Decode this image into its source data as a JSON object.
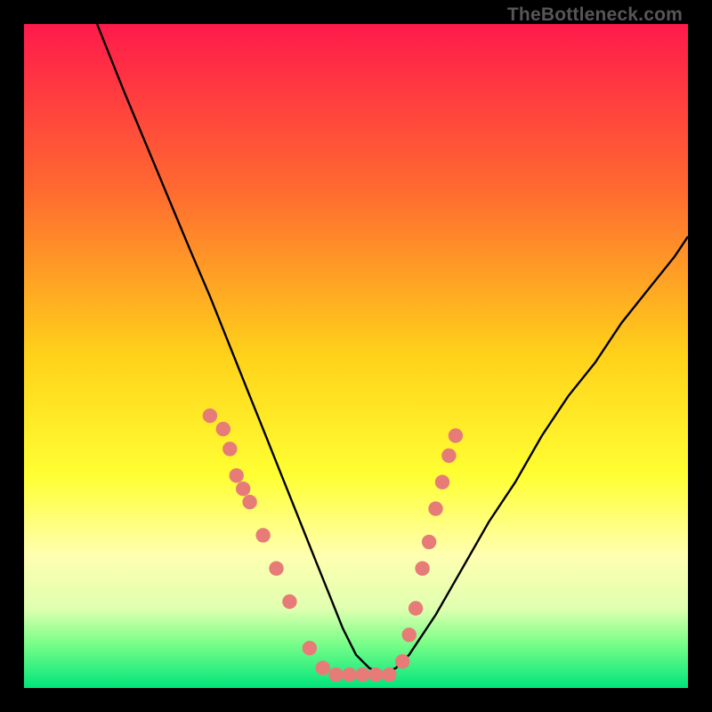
{
  "watermark": "TheBottleneck.com",
  "chart_data": {
    "type": "line",
    "title": "",
    "xlabel": "",
    "ylabel": "",
    "xlim": [
      0,
      100
    ],
    "ylim": [
      0,
      100
    ],
    "grid": false,
    "legend": false,
    "background_gradient": {
      "stops": [
        {
          "offset": 0.0,
          "color": "#ff1a4b"
        },
        {
          "offset": 0.25,
          "color": "#ff6a30"
        },
        {
          "offset": 0.5,
          "color": "#ffd21a"
        },
        {
          "offset": 0.68,
          "color": "#ffff33"
        },
        {
          "offset": 0.8,
          "color": "#ffffb0"
        },
        {
          "offset": 0.88,
          "color": "#e0ffb0"
        },
        {
          "offset": 0.93,
          "color": "#7fff8a"
        },
        {
          "offset": 1.0,
          "color": "#00e57a"
        }
      ]
    },
    "series": [
      {
        "name": "bottleneck-curve",
        "color": "#000000",
        "x": [
          11,
          15,
          20,
          25,
          28,
          30,
          32,
          34,
          36,
          38,
          40,
          42,
          44,
          46,
          48,
          50,
          52,
          54,
          56,
          58,
          62,
          66,
          70,
          74,
          78,
          82,
          86,
          90,
          94,
          98,
          100
        ],
        "y": [
          100,
          90,
          78,
          66,
          59,
          54,
          49,
          44,
          39,
          34,
          29,
          24,
          19,
          14,
          9,
          5,
          3,
          2,
          3,
          5,
          11,
          18,
          25,
          31,
          38,
          44,
          49,
          55,
          60,
          65,
          68
        ]
      }
    ],
    "points": {
      "name": "datapoints",
      "color": "#e77b78",
      "radius_pct": 1.1,
      "xy": [
        [
          28,
          41
        ],
        [
          30,
          39
        ],
        [
          31,
          36
        ],
        [
          32,
          32
        ],
        [
          33,
          30
        ],
        [
          34,
          28
        ],
        [
          36,
          23
        ],
        [
          38,
          18
        ],
        [
          40,
          13
        ],
        [
          43,
          6
        ],
        [
          45,
          3
        ],
        [
          47,
          2
        ],
        [
          49,
          2
        ],
        [
          51,
          2
        ],
        [
          53,
          2
        ],
        [
          55,
          2
        ],
        [
          57,
          4
        ],
        [
          58,
          8
        ],
        [
          59,
          12
        ],
        [
          60,
          18
        ],
        [
          61,
          22
        ],
        [
          62,
          27
        ],
        [
          63,
          31
        ],
        [
          64,
          35
        ],
        [
          65,
          38
        ]
      ]
    }
  }
}
